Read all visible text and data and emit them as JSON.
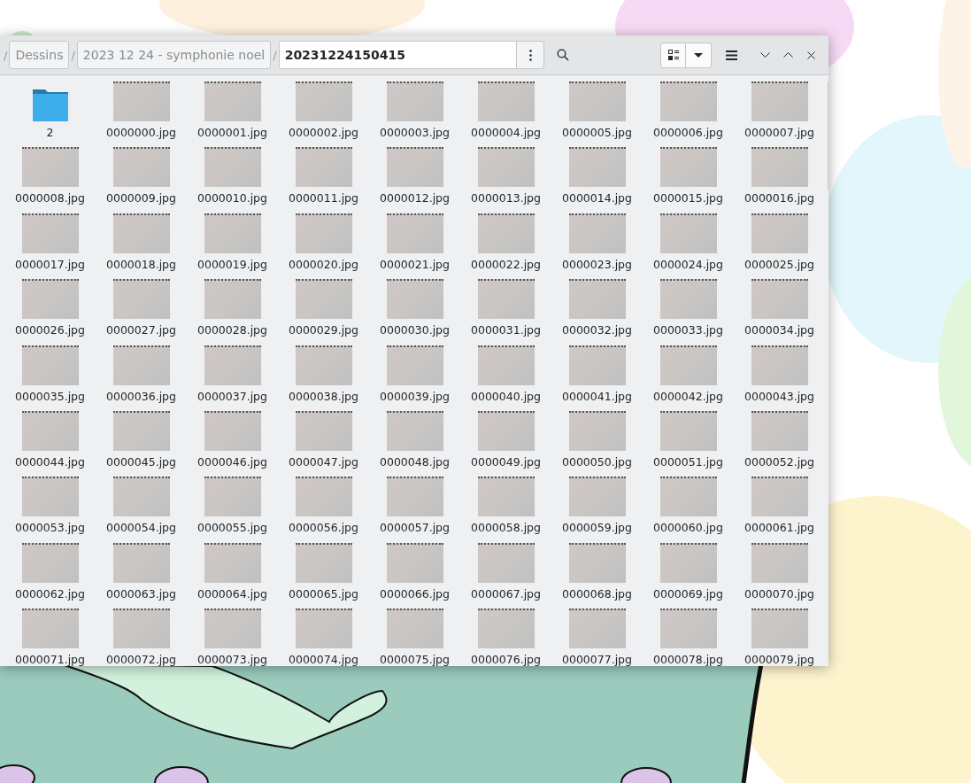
{
  "breadcrumb": [
    {
      "separator": "/",
      "label": "Dessins",
      "selected": false
    },
    {
      "separator": "/",
      "label": "2023 12 24 - symphonie noel",
      "selected": false
    },
    {
      "separator": "/",
      "label": "20231224150415",
      "selected": true
    }
  ],
  "items": [
    {
      "kind": "folder",
      "label": "2"
    },
    {
      "kind": "image",
      "label": "0000000.jpg"
    },
    {
      "kind": "image",
      "label": "0000001.jpg"
    },
    {
      "kind": "image",
      "label": "0000002.jpg"
    },
    {
      "kind": "image",
      "label": "0000003.jpg"
    },
    {
      "kind": "image",
      "label": "0000004.jpg"
    },
    {
      "kind": "image",
      "label": "0000005.jpg"
    },
    {
      "kind": "image",
      "label": "0000006.jpg"
    },
    {
      "kind": "image",
      "label": "0000007.jpg"
    },
    {
      "kind": "image",
      "label": "0000008.jpg"
    },
    {
      "kind": "image",
      "label": "0000009.jpg"
    },
    {
      "kind": "image",
      "label": "0000010.jpg"
    },
    {
      "kind": "image",
      "label": "0000011.jpg"
    },
    {
      "kind": "image",
      "label": "0000012.jpg"
    },
    {
      "kind": "image",
      "label": "0000013.jpg"
    },
    {
      "kind": "image",
      "label": "0000014.jpg"
    },
    {
      "kind": "image",
      "label": "0000015.jpg"
    },
    {
      "kind": "image",
      "label": "0000016.jpg"
    },
    {
      "kind": "image",
      "label": "0000017.jpg"
    },
    {
      "kind": "image",
      "label": "0000018.jpg"
    },
    {
      "kind": "image",
      "label": "0000019.jpg"
    },
    {
      "kind": "image",
      "label": "0000020.jpg"
    },
    {
      "kind": "image",
      "label": "0000021.jpg"
    },
    {
      "kind": "image",
      "label": "0000022.jpg"
    },
    {
      "kind": "image",
      "label": "0000023.jpg"
    },
    {
      "kind": "image",
      "label": "0000024.jpg"
    },
    {
      "kind": "image",
      "label": "0000025.jpg"
    },
    {
      "kind": "image",
      "label": "0000026.jpg"
    },
    {
      "kind": "image",
      "label": "0000027.jpg"
    },
    {
      "kind": "image",
      "label": "0000028.jpg"
    },
    {
      "kind": "image",
      "label": "0000029.jpg"
    },
    {
      "kind": "image",
      "label": "0000030.jpg"
    },
    {
      "kind": "image",
      "label": "0000031.jpg"
    },
    {
      "kind": "image",
      "label": "0000032.jpg"
    },
    {
      "kind": "image",
      "label": "0000033.jpg"
    },
    {
      "kind": "image",
      "label": "0000034.jpg"
    },
    {
      "kind": "image",
      "label": "0000035.jpg"
    },
    {
      "kind": "image",
      "label": "0000036.jpg"
    },
    {
      "kind": "image",
      "label": "0000037.jpg"
    },
    {
      "kind": "image",
      "label": "0000038.jpg"
    },
    {
      "kind": "image",
      "label": "0000039.jpg"
    },
    {
      "kind": "image",
      "label": "0000040.jpg"
    },
    {
      "kind": "image",
      "label": "0000041.jpg"
    },
    {
      "kind": "image",
      "label": "0000042.jpg"
    },
    {
      "kind": "image",
      "label": "0000043.jpg"
    },
    {
      "kind": "image",
      "label": "0000044.jpg"
    },
    {
      "kind": "image",
      "label": "0000045.jpg"
    },
    {
      "kind": "image",
      "label": "0000046.jpg"
    },
    {
      "kind": "image",
      "label": "0000047.jpg"
    },
    {
      "kind": "image",
      "label": "0000048.jpg"
    },
    {
      "kind": "image",
      "label": "0000049.jpg"
    },
    {
      "kind": "image",
      "label": "0000050.jpg"
    },
    {
      "kind": "image",
      "label": "0000051.jpg"
    },
    {
      "kind": "image",
      "label": "0000052.jpg"
    },
    {
      "kind": "image",
      "label": "0000053.jpg"
    },
    {
      "kind": "image",
      "label": "0000054.jpg"
    },
    {
      "kind": "image",
      "label": "0000055.jpg"
    },
    {
      "kind": "image",
      "label": "0000056.jpg"
    },
    {
      "kind": "image",
      "label": "0000057.jpg"
    },
    {
      "kind": "image",
      "label": "0000058.jpg"
    },
    {
      "kind": "image",
      "label": "0000059.jpg"
    },
    {
      "kind": "image",
      "label": "0000060.jpg"
    },
    {
      "kind": "image",
      "label": "0000061.jpg"
    },
    {
      "kind": "image",
      "label": "0000062.jpg"
    },
    {
      "kind": "image",
      "label": "0000063.jpg"
    },
    {
      "kind": "image",
      "label": "0000064.jpg"
    },
    {
      "kind": "image",
      "label": "0000065.jpg"
    },
    {
      "kind": "image",
      "label": "0000066.jpg"
    },
    {
      "kind": "image",
      "label": "0000067.jpg"
    },
    {
      "kind": "image",
      "label": "0000068.jpg"
    },
    {
      "kind": "image",
      "label": "0000069.jpg"
    },
    {
      "kind": "image",
      "label": "0000070.jpg"
    },
    {
      "kind": "image",
      "label": "0000071.jpg"
    },
    {
      "kind": "image",
      "label": "0000072.jpg"
    },
    {
      "kind": "image",
      "label": "0000073.jpg"
    },
    {
      "kind": "image",
      "label": "0000074.jpg"
    },
    {
      "kind": "image",
      "label": "0000075.jpg"
    },
    {
      "kind": "image",
      "label": "0000076.jpg"
    },
    {
      "kind": "image",
      "label": "0000077.jpg"
    },
    {
      "kind": "image",
      "label": "0000078.jpg"
    },
    {
      "kind": "image",
      "label": "0000079.jpg"
    }
  ]
}
